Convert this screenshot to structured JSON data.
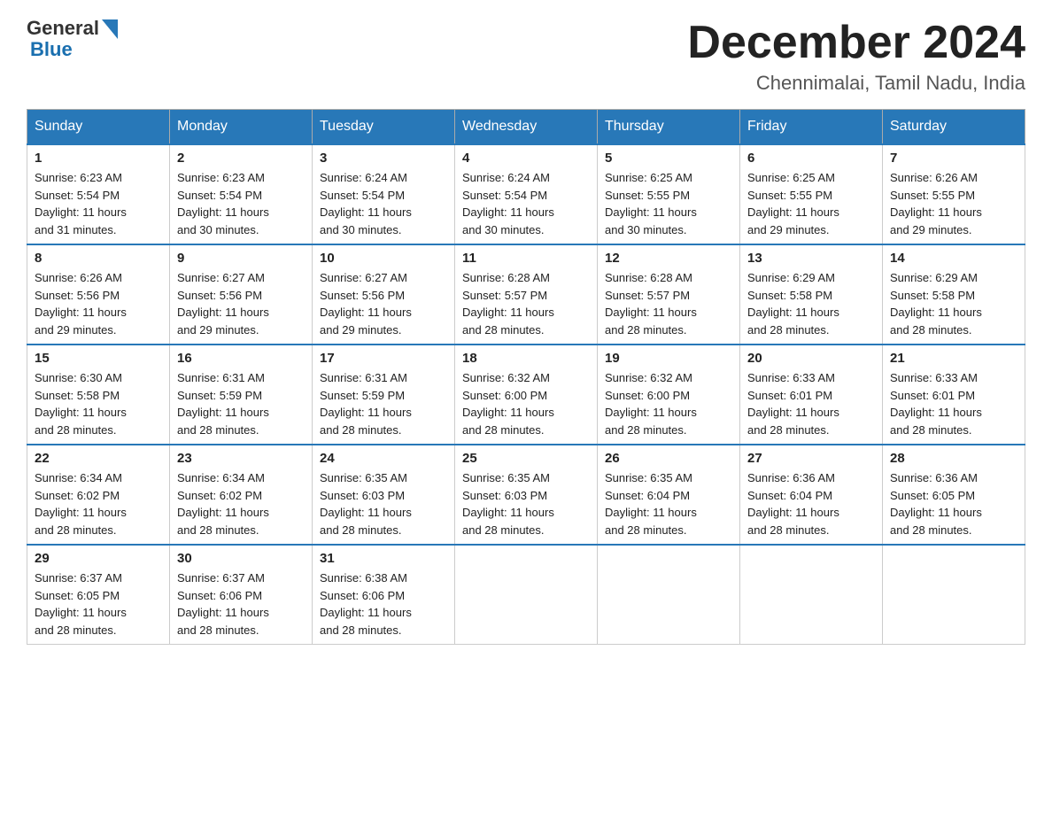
{
  "logo": {
    "text_general": "General",
    "text_blue": "Blue"
  },
  "title": {
    "month_year": "December 2024",
    "location": "Chennimalai, Tamil Nadu, India"
  },
  "headers": [
    "Sunday",
    "Monday",
    "Tuesday",
    "Wednesday",
    "Thursday",
    "Friday",
    "Saturday"
  ],
  "weeks": [
    [
      {
        "day": "1",
        "sunrise": "6:23 AM",
        "sunset": "5:54 PM",
        "daylight": "11 hours and 31 minutes."
      },
      {
        "day": "2",
        "sunrise": "6:23 AM",
        "sunset": "5:54 PM",
        "daylight": "11 hours and 30 minutes."
      },
      {
        "day": "3",
        "sunrise": "6:24 AM",
        "sunset": "5:54 PM",
        "daylight": "11 hours and 30 minutes."
      },
      {
        "day": "4",
        "sunrise": "6:24 AM",
        "sunset": "5:54 PM",
        "daylight": "11 hours and 30 minutes."
      },
      {
        "day": "5",
        "sunrise": "6:25 AM",
        "sunset": "5:55 PM",
        "daylight": "11 hours and 30 minutes."
      },
      {
        "day": "6",
        "sunrise": "6:25 AM",
        "sunset": "5:55 PM",
        "daylight": "11 hours and 29 minutes."
      },
      {
        "day": "7",
        "sunrise": "6:26 AM",
        "sunset": "5:55 PM",
        "daylight": "11 hours and 29 minutes."
      }
    ],
    [
      {
        "day": "8",
        "sunrise": "6:26 AM",
        "sunset": "5:56 PM",
        "daylight": "11 hours and 29 minutes."
      },
      {
        "day": "9",
        "sunrise": "6:27 AM",
        "sunset": "5:56 PM",
        "daylight": "11 hours and 29 minutes."
      },
      {
        "day": "10",
        "sunrise": "6:27 AM",
        "sunset": "5:56 PM",
        "daylight": "11 hours and 29 minutes."
      },
      {
        "day": "11",
        "sunrise": "6:28 AM",
        "sunset": "5:57 PM",
        "daylight": "11 hours and 28 minutes."
      },
      {
        "day": "12",
        "sunrise": "6:28 AM",
        "sunset": "5:57 PM",
        "daylight": "11 hours and 28 minutes."
      },
      {
        "day": "13",
        "sunrise": "6:29 AM",
        "sunset": "5:58 PM",
        "daylight": "11 hours and 28 minutes."
      },
      {
        "day": "14",
        "sunrise": "6:29 AM",
        "sunset": "5:58 PM",
        "daylight": "11 hours and 28 minutes."
      }
    ],
    [
      {
        "day": "15",
        "sunrise": "6:30 AM",
        "sunset": "5:58 PM",
        "daylight": "11 hours and 28 minutes."
      },
      {
        "day": "16",
        "sunrise": "6:31 AM",
        "sunset": "5:59 PM",
        "daylight": "11 hours and 28 minutes."
      },
      {
        "day": "17",
        "sunrise": "6:31 AM",
        "sunset": "5:59 PM",
        "daylight": "11 hours and 28 minutes."
      },
      {
        "day": "18",
        "sunrise": "6:32 AM",
        "sunset": "6:00 PM",
        "daylight": "11 hours and 28 minutes."
      },
      {
        "day": "19",
        "sunrise": "6:32 AM",
        "sunset": "6:00 PM",
        "daylight": "11 hours and 28 minutes."
      },
      {
        "day": "20",
        "sunrise": "6:33 AM",
        "sunset": "6:01 PM",
        "daylight": "11 hours and 28 minutes."
      },
      {
        "day": "21",
        "sunrise": "6:33 AM",
        "sunset": "6:01 PM",
        "daylight": "11 hours and 28 minutes."
      }
    ],
    [
      {
        "day": "22",
        "sunrise": "6:34 AM",
        "sunset": "6:02 PM",
        "daylight": "11 hours and 28 minutes."
      },
      {
        "day": "23",
        "sunrise": "6:34 AM",
        "sunset": "6:02 PM",
        "daylight": "11 hours and 28 minutes."
      },
      {
        "day": "24",
        "sunrise": "6:35 AM",
        "sunset": "6:03 PM",
        "daylight": "11 hours and 28 minutes."
      },
      {
        "day": "25",
        "sunrise": "6:35 AM",
        "sunset": "6:03 PM",
        "daylight": "11 hours and 28 minutes."
      },
      {
        "day": "26",
        "sunrise": "6:35 AM",
        "sunset": "6:04 PM",
        "daylight": "11 hours and 28 minutes."
      },
      {
        "day": "27",
        "sunrise": "6:36 AM",
        "sunset": "6:04 PM",
        "daylight": "11 hours and 28 minutes."
      },
      {
        "day": "28",
        "sunrise": "6:36 AM",
        "sunset": "6:05 PM",
        "daylight": "11 hours and 28 minutes."
      }
    ],
    [
      {
        "day": "29",
        "sunrise": "6:37 AM",
        "sunset": "6:05 PM",
        "daylight": "11 hours and 28 minutes."
      },
      {
        "day": "30",
        "sunrise": "6:37 AM",
        "sunset": "6:06 PM",
        "daylight": "11 hours and 28 minutes."
      },
      {
        "day": "31",
        "sunrise": "6:38 AM",
        "sunset": "6:06 PM",
        "daylight": "11 hours and 28 minutes."
      },
      null,
      null,
      null,
      null
    ]
  ],
  "labels": {
    "sunrise_prefix": "Sunrise: ",
    "sunset_prefix": "Sunset: ",
    "daylight_prefix": "Daylight: "
  }
}
